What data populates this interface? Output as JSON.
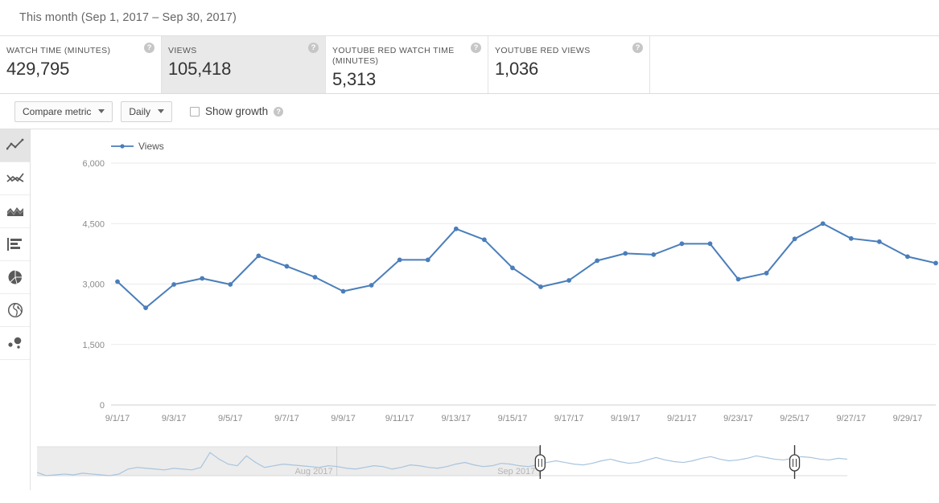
{
  "date_range": {
    "label": "This month (Sep 1, 2017 – Sep 30, 2017)"
  },
  "metric_cards": [
    {
      "label": "WATCH TIME (MINUTES)",
      "value": "429,795",
      "selected": false,
      "help": "?"
    },
    {
      "label": "VIEWS",
      "value": "105,418",
      "selected": true,
      "help": "?"
    },
    {
      "label": "YOUTUBE RED WATCH TIME (MINUTES)",
      "value": "5,313",
      "selected": false,
      "help": "?"
    },
    {
      "label": "YOUTUBE RED VIEWS",
      "value": "1,036",
      "selected": false,
      "help": "?"
    }
  ],
  "toolbar": {
    "compare_metric_label": "Compare metric",
    "interval_label": "Daily",
    "show_growth_label": "Show growth",
    "show_growth_checked": false,
    "help": "?"
  },
  "sidebar": {
    "items": [
      {
        "name": "line-chart",
        "icon": "line-chart-icon",
        "active": true
      },
      {
        "name": "multi-line-chart",
        "icon": "multiline-chart-icon",
        "active": false
      },
      {
        "name": "area-chart",
        "icon": "area-chart-icon",
        "active": false
      },
      {
        "name": "bar-chart",
        "icon": "bar-chart-icon",
        "active": false
      },
      {
        "name": "pie-chart",
        "icon": "pie-chart-icon",
        "active": false
      },
      {
        "name": "geography-map",
        "icon": "globe-icon",
        "active": false
      },
      {
        "name": "bubble-chart",
        "icon": "bubble-chart-icon",
        "active": false
      }
    ]
  },
  "scrubber": {
    "left_month_label": "Aug 2017",
    "right_month_label": "Sep 2017",
    "left_handle_pct": 62.1,
    "right_handle_pct": 93.5,
    "handle_icon": "drag-handle-icon"
  },
  "colors": {
    "series": "#4a7ebb",
    "grid": "#eaeaea",
    "axis_text": "#8a8a8a",
    "card_selected": "#e9e9e9",
    "scrubber_line": "#a8c4de",
    "scrubber_dim": "#ececec"
  },
  "chart_data": {
    "type": "line",
    "title": "",
    "xlabel": "",
    "ylabel": "",
    "ylim": [
      0,
      6000
    ],
    "yticks": [
      0,
      1500,
      3000,
      4500,
      6000
    ],
    "ytick_labels": [
      "0",
      "1,500",
      "3,000",
      "4,500",
      "6,000"
    ],
    "grid": true,
    "legend": [
      "Views"
    ],
    "legend_position": "top-left",
    "x_tick_labels": [
      "9/1/17",
      "9/3/17",
      "9/5/17",
      "9/7/17",
      "9/9/17",
      "9/11/17",
      "9/13/17",
      "9/15/17",
      "9/17/17",
      "9/19/17",
      "9/21/17",
      "9/23/17",
      "9/25/17",
      "9/27/17",
      "9/29/17"
    ],
    "categories": [
      "9/1/17",
      "9/2/17",
      "9/3/17",
      "9/4/17",
      "9/5/17",
      "9/6/17",
      "9/7/17",
      "9/8/17",
      "9/9/17",
      "9/10/17",
      "9/11/17",
      "9/12/17",
      "9/13/17",
      "9/14/17",
      "9/15/17",
      "9/16/17",
      "9/17/17",
      "9/18/17",
      "9/19/17",
      "9/20/17",
      "9/21/17",
      "9/22/17",
      "9/23/17",
      "9/24/17",
      "9/25/17",
      "9/26/17",
      "9/27/17",
      "9/28/17",
      "9/29/17",
      "9/30/17"
    ],
    "series": [
      {
        "name": "Views",
        "color": "#4a7ebb",
        "values": [
          3060,
          2410,
          2990,
          3140,
          2990,
          3700,
          3440,
          3170,
          2820,
          2970,
          3600,
          3600,
          4370,
          4100,
          3400,
          2930,
          3090,
          3580,
          3760,
          3730,
          4000,
          4000,
          3120,
          3270,
          4120,
          4500,
          4130,
          4050,
          3680,
          3520
        ]
      }
    ],
    "overview_series": {
      "name": "Views overview",
      "values": [
        18,
        14,
        15,
        16,
        15,
        17,
        16,
        15,
        14,
        16,
        22,
        24,
        23,
        22,
        21,
        23,
        22,
        21,
        24,
        42,
        34,
        28,
        26,
        38,
        30,
        24,
        26,
        28,
        27,
        26,
        25,
        24,
        26,
        25,
        23,
        22,
        24,
        26,
        25,
        22,
        24,
        27,
        26,
        24,
        23,
        25,
        28,
        30,
        27,
        25,
        26,
        29,
        28,
        26,
        25,
        27,
        30,
        32,
        30,
        28,
        27,
        29,
        32,
        34,
        31,
        29,
        30,
        33,
        36,
        33,
        31,
        30,
        32,
        35,
        37,
        34,
        32,
        33,
        35,
        38,
        36,
        34,
        33,
        35,
        37,
        36,
        34,
        33,
        35,
        34
      ]
    }
  }
}
